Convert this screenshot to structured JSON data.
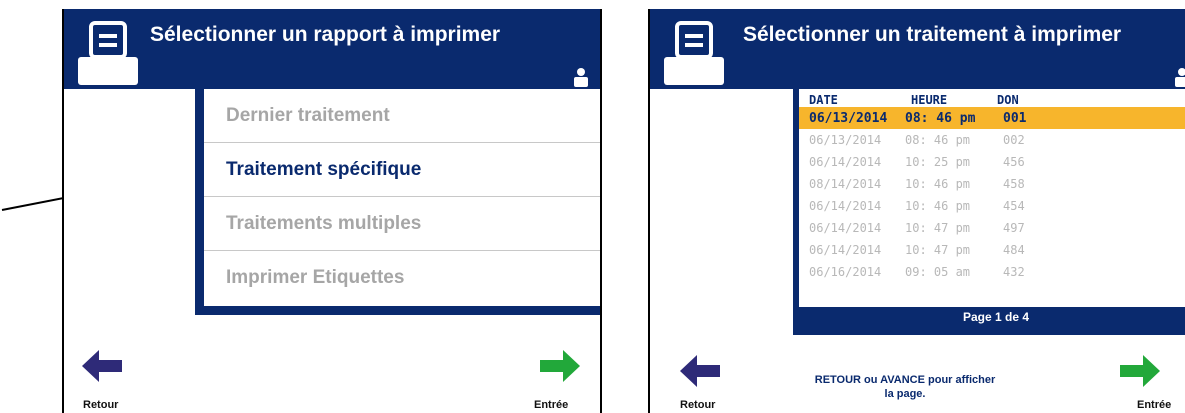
{
  "left_screen": {
    "title": "Sélectionner un rapport à imprimer",
    "menu_items": [
      {
        "label": "Dernier traitement",
        "state": "disabled"
      },
      {
        "label": "Traitement spécifique",
        "state": "active"
      },
      {
        "label": "Traitements multiples",
        "state": "disabled"
      },
      {
        "label": "Imprimer Etiquettes",
        "state": "disabled"
      }
    ],
    "back_label": "Retour",
    "enter_label": "Entrée"
  },
  "right_screen": {
    "title": "Sélectionner un traitement à imprimer",
    "columns": {
      "date": "DATE",
      "time": "HEURE",
      "don": "DON"
    },
    "rows": [
      {
        "date": "06/13/2014",
        "time": "08: 46  pm",
        "don": "001",
        "selected": true
      },
      {
        "date": "06/13/2014",
        "time": "08: 46  pm",
        "don": "002",
        "selected": false
      },
      {
        "date": "06/14/2014",
        "time": "10: 25  pm",
        "don": "456",
        "selected": false
      },
      {
        "date": "08/14/2014",
        "time": "10: 46  pm",
        "don": "458",
        "selected": false
      },
      {
        "date": "06/14/2014",
        "time": "10: 46  pm",
        "don": "454",
        "selected": false
      },
      {
        "date": "06/14/2014",
        "time": "10: 47  pm",
        "don": "497",
        "selected": false
      },
      {
        "date": "06/14/2014",
        "time": "10: 47  pm",
        "don": "484",
        "selected": false
      },
      {
        "date": "06/16/2014",
        "time": "09: 05  am",
        "don": "432",
        "selected": false
      }
    ],
    "page_label": "Page 1 de 4",
    "hint_line1": "RETOUR ou AVANCE pour afficher",
    "hint_line2": "la page.",
    "back_label": "Retour",
    "enter_label": "Entrée"
  },
  "colors": {
    "header_blue": "#0a2a6e",
    "selection_orange": "#f7b52c",
    "back_arrow": "#2e2a78",
    "enter_arrow": "#22a83a",
    "disabled_text": "#a6a6a6"
  },
  "icons": [
    "printer-icon",
    "person-icon",
    "back-arrow-icon",
    "enter-arrow-icon",
    "pointer-arrow-icon"
  ]
}
